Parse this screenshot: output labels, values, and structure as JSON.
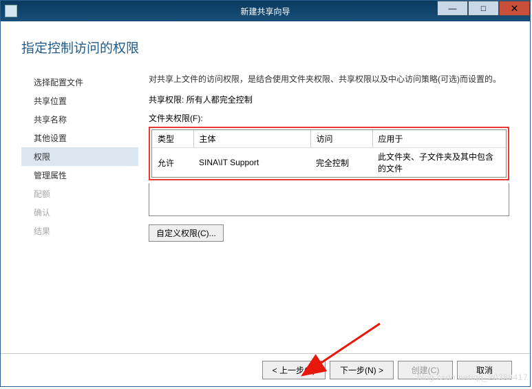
{
  "titlebar": {
    "text": "新建共享向导"
  },
  "page_title": "指定控制访问的权限",
  "sidebar": {
    "items": [
      {
        "label": "选择配置文件",
        "state": "normal"
      },
      {
        "label": "共享位置",
        "state": "normal"
      },
      {
        "label": "共享名称",
        "state": "normal"
      },
      {
        "label": "其他设置",
        "state": "normal"
      },
      {
        "label": "权限",
        "state": "active"
      },
      {
        "label": "管理属性",
        "state": "normal"
      },
      {
        "label": "配额",
        "state": "disabled"
      },
      {
        "label": "确认",
        "state": "disabled"
      },
      {
        "label": "结果",
        "state": "disabled"
      }
    ]
  },
  "main": {
    "description": "对共享上文件的访问权限，是结合使用文件夹权限、共享权限以及中心访问策略(可选)而设置的。",
    "share_perm_label": "共享权限:",
    "share_perm_value": "所有人都完全控制",
    "folder_perm_label": "文件夹权限(F):",
    "table": {
      "headers": [
        "类型",
        "主体",
        "访问",
        "应用于"
      ],
      "rows": [
        {
          "type": "允许",
          "principal": "SINA\\IT Support",
          "access": "完全控制",
          "applies": "此文件夹、子文件夹及其中包含的文件"
        }
      ]
    },
    "custom_button": "自定义权限(C)..."
  },
  "footer": {
    "prev": "< 上一步(P)",
    "next": "下一步(N) >",
    "create": "创建(C)",
    "cancel": "取消"
  },
  "watermark": "blog.csdn.net/qq_20388417"
}
